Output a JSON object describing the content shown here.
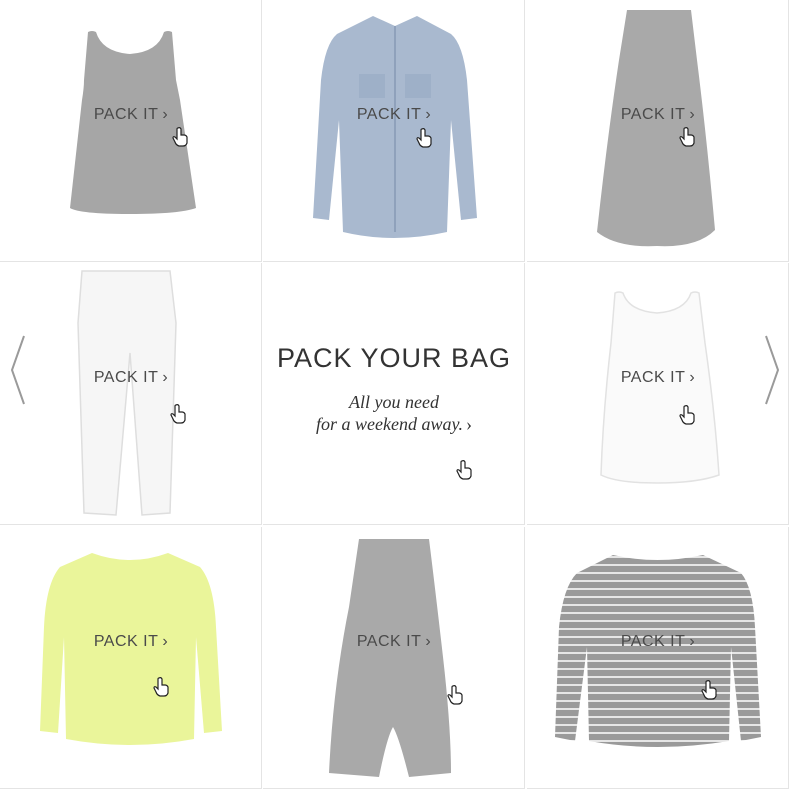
{
  "center": {
    "title": "PACK YOUR BAG",
    "subtitle_line1": "All you need",
    "subtitle_line2": "for a weekend away.",
    "chevron": "›"
  },
  "items": [
    {
      "label": "PACK IT",
      "chevron": "›",
      "icon": "tank-top-grey"
    },
    {
      "label": "PACK IT",
      "chevron": "›",
      "icon": "chambray-shirt"
    },
    {
      "label": "PACK IT",
      "chevron": "›",
      "icon": "maxi-skirt-grey"
    },
    {
      "label": "PACK IT",
      "chevron": "›",
      "icon": "white-jeans"
    },
    {
      "label": "PACK IT",
      "chevron": "›",
      "icon": "white-tank-top"
    },
    {
      "label": "PACK IT",
      "chevron": "›",
      "icon": "yellow-sweater"
    },
    {
      "label": "PACK IT",
      "chevron": "›",
      "icon": "grey-harem-pants"
    },
    {
      "label": "PACK IT",
      "chevron": "›",
      "icon": "striped-sweater"
    }
  ],
  "nav": {
    "prev_icon": "chevron-left-icon",
    "next_icon": "chevron-right-icon"
  },
  "colors": {
    "grey_fabric": "#a6a6a6",
    "chambray": "#a9b9cf",
    "yellow": "#eaf59a",
    "border": "#e4e4e4",
    "text": "#4a4a4a"
  }
}
